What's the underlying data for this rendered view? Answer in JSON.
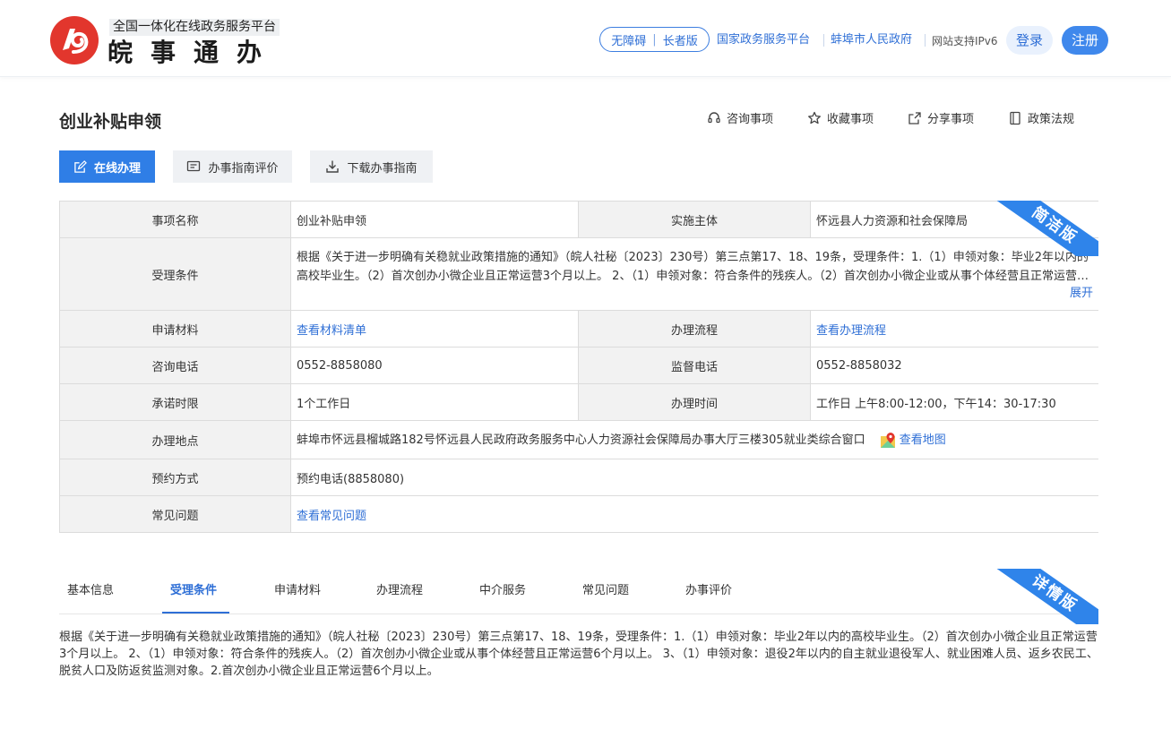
{
  "header": {
    "platform_subtitle": "全国一体化在线政务服务平台",
    "brand": "皖事通办",
    "accessibility": "无障碍",
    "elder_mode": "长者版",
    "links": [
      "国家政务服务平台",
      "蚌埠市人民政府"
    ],
    "ipv6_text": "网站支持IPv6",
    "login": "登录",
    "register": "注册"
  },
  "page": {
    "title": "创业补贴申领",
    "actions": [
      "咨询事项",
      "收藏事项",
      "分享事项",
      "政策法规"
    ],
    "buttons": {
      "online": "在线办理",
      "evaluate": "办事指南评价",
      "download": "下载办事指南"
    }
  },
  "info": {
    "ribbon": "简洁版",
    "item_name_label": "事项名称",
    "item_name": "创业补贴申领",
    "subject_label": "实施主体",
    "subject": "怀远县人力资源和社会保障局",
    "condition_label": "受理条件",
    "condition": "根据《关于进一步明确有关稳就业政策措施的通知》（皖人社秘〔2023〕230号）第三点第17、18、19条，受理条件：1.（1）申领对象：毕业2年以内的高校毕业生。（2）首次创办小微企业且正常运营3个月以上。 2、（1）申领对象：符合条件的残疾人。（2）首次创办小微企业或从事个体经营且正常运营6个月以上。",
    "expand": "展开",
    "materials_label": "申请材料",
    "materials_link": "查看材料清单",
    "process_label": "办理流程",
    "process_link": "查看办理流程",
    "consult_phone_label": "咨询电话",
    "consult_phone": "0552-8858080",
    "supervise_phone_label": "监督电话",
    "supervise_phone": "0552-8858032",
    "time_limit_label": "承诺时限",
    "time_limit": "1个工作日",
    "hours_label": "办理时间",
    "hours": "工作日 上午8:00-12:00，下午14：30-17:30",
    "address_label": "办理地点",
    "address": "蚌埠市怀远县榴城路182号怀远县人民政府政务服务中心人力资源社会保障局办事大厅三楼305就业类综合窗口",
    "map_link": "查看地图",
    "appointment_label": "预约方式",
    "appointment": "预约电话(8858080)",
    "faq_label": "常见问题",
    "faq_link": "查看常见问题"
  },
  "tabs": {
    "ribbon": "详情版",
    "items": [
      "基本信息",
      "受理条件",
      "申请材料",
      "办理流程",
      "中介服务",
      "常见问题",
      "办事评价"
    ],
    "active": "受理条件"
  },
  "detail": {
    "text": "根据《关于进一步明确有关稳就业政策措施的通知》（皖人社秘〔2023〕230号）第三点第17、18、19条，受理条件：1.（1）申领对象：毕业2年以内的高校毕业生。（2）首次创办小微企业且正常运营3个月以上。 2、（1）申领对象：符合条件的残疾人。（2）首次创办小微企业或从事个体经营且正常运营6个月以上。 3、（1）申领对象：退役2年以内的自主就业退役军人、就业困难人员、返乡农民工、脱贫人口及防返贫监测对象。2.首次创办小微企业且正常运营6个月以上。"
  },
  "colors": {
    "primary": "#2f7ee6",
    "link": "#2f6fd6",
    "logo_red": "#e2362d"
  }
}
